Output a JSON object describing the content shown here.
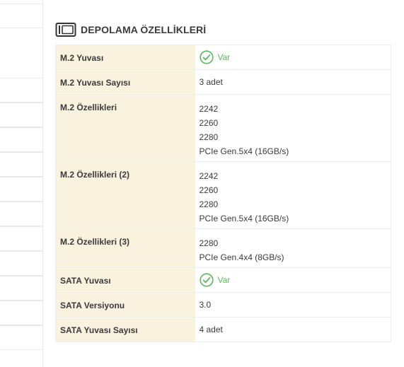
{
  "section": {
    "title": "DEPOLAMA ÖZELLİKLERİ",
    "icon": "ssd-drive-icon"
  },
  "colors": {
    "key_bg": "#f8f2de",
    "check_green": "#5cb85c",
    "border": "#ededed"
  },
  "rows": [
    {
      "label": "M.2 Yuvası",
      "value": "Var",
      "type": "check"
    },
    {
      "label": "M.2 Yuvası Sayısı",
      "value": "3 adet"
    },
    {
      "label": "M.2 Özellikleri",
      "lines": [
        "2242",
        "2260",
        "2280",
        "PCIe Gen.5x4 (16GB/s)"
      ]
    },
    {
      "label": "M.2 Özellikleri (2)",
      "lines": [
        "2242",
        "2260",
        "2280",
        "PCIe Gen.5x4 (16GB/s)"
      ]
    },
    {
      "label": "M.2 Özellikleri (3)",
      "lines": [
        "2280",
        "PCIe Gen.4x4 (8GB/s)"
      ]
    },
    {
      "label": "SATA Yuvası",
      "value": "Var",
      "type": "check"
    },
    {
      "label": "SATA Versiyonu",
      "value": "3.0"
    },
    {
      "label": "SATA Yuvası Sayısı",
      "value": "4 adet"
    }
  ]
}
